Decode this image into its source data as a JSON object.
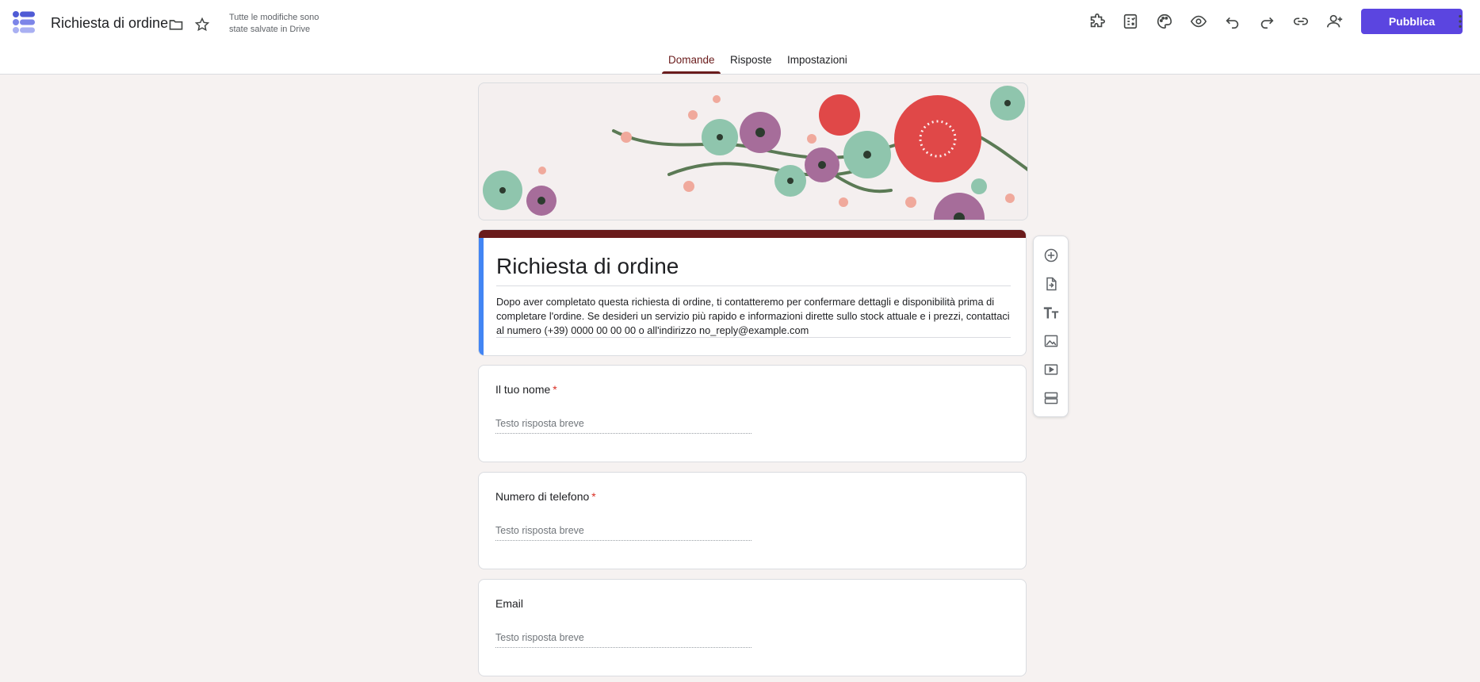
{
  "header": {
    "doc_title": "Richiesta di ordine",
    "save_status": "Tutte le modifiche sono state salvate in Drive",
    "publish_label": "Pubblica",
    "icons": [
      "addons-icon",
      "quiz-icon",
      "palette-icon",
      "preview-eye-icon",
      "undo-icon",
      "redo-icon",
      "link-icon",
      "add-collaborator-icon",
      "more-vert-icon"
    ]
  },
  "tabs": [
    {
      "label": "Domande",
      "active": true
    },
    {
      "label": "Risposte",
      "active": false
    },
    {
      "label": "Impostazioni",
      "active": false
    }
  ],
  "form": {
    "title": "Richiesta di ordine",
    "description": "Dopo aver completato questa richiesta di ordine, ti contatteremo per confermare dettagli e disponibilità prima di completare l'ordine. Se desideri un servizio più rapido e informazioni dirette sullo stock attuale e i prezzi, contattaci al numero (+39) 0000 00 00 00 o all'indirizzo no_reply@example.com"
  },
  "questions": [
    {
      "label": "Il tuo nome",
      "required": true,
      "required_mark": "*",
      "placeholder": "Testo risposta breve"
    },
    {
      "label": "Numero di telefono",
      "required": true,
      "required_mark": "*",
      "placeholder": "Testo risposta breve"
    },
    {
      "label": "Email",
      "required": false,
      "required_mark": "",
      "placeholder": "Testo risposta breve"
    }
  ],
  "side_toolbar": {
    "icons": [
      "add-question-icon",
      "import-questions-icon",
      "add-title-icon",
      "add-image-icon",
      "add-video-icon",
      "add-section-icon"
    ]
  },
  "colors": {
    "accent": "#6a1b1b",
    "publish": "#5b45e0",
    "focus_strip": "#4285f4",
    "background": "#f6f2f1"
  }
}
